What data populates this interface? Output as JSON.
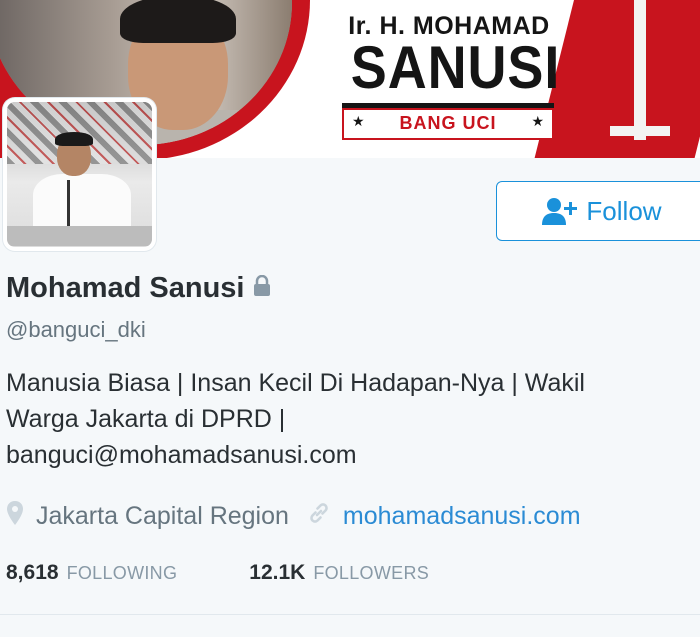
{
  "banner": {
    "title_top": "Ir. H. MOHAMAD",
    "title_main": "SANUSI",
    "nickname": "BANG UCI",
    "star_left": "★",
    "star_right": "★"
  },
  "follow_button": {
    "label": "Follow",
    "icon": "add-user-icon",
    "color": "#1a91da"
  },
  "profile": {
    "name": "Mohamad Sanusi",
    "protected_icon": "lock-icon",
    "handle": "@banguci_dki",
    "bio_lines": [
      "Manusia Biasa | Insan Kecil Di Hadapan-Nya | Wakil",
      "Warga Jakarta di DPRD |",
      "banguci@mohamadsanusi.com"
    ],
    "location": "Jakarta Capital Region",
    "location_icon": "location-pin-icon",
    "website": "mohamadsanusi.com",
    "website_icon": "link-icon"
  },
  "stats": {
    "following_count": "8,618",
    "following_label": "FOLLOWING",
    "followers_count": "12.1K",
    "followers_label": "FOLLOWERS"
  },
  "colors": {
    "accent": "#1a91da",
    "banner_red": "#c8141e",
    "link": "#2b8bd4",
    "muted": "#8899a6"
  }
}
